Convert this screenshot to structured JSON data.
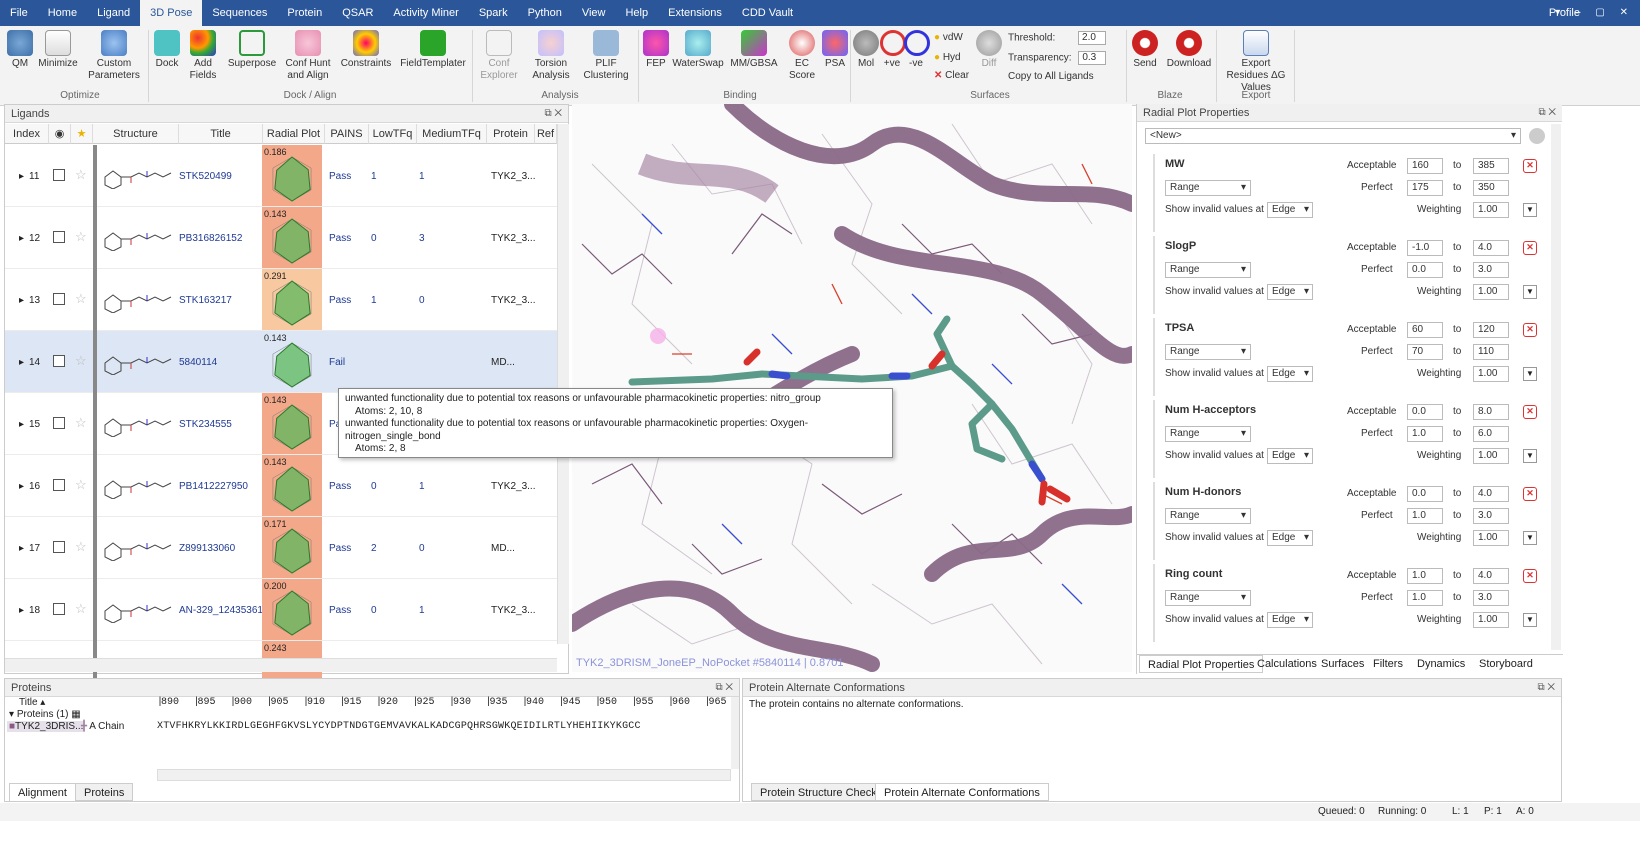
{
  "menubar": {
    "items": [
      "File",
      "Home",
      "Ligand",
      "3D Pose",
      "Sequences",
      "Protein",
      "QSAR",
      "Activity Miner",
      "Spark",
      "Python",
      "View",
      "Help",
      "Extensions",
      "CDD Vault"
    ],
    "active": "3D Pose",
    "profile": "Profile"
  },
  "ribbon": {
    "buttons": [
      {
        "label": "QM",
        "icon": "qm-icon"
      },
      {
        "label": "Minimize",
        "icon": "minimize-icon"
      },
      {
        "label": "Custom Parameters",
        "icon": "custom-parameters-icon"
      },
      {
        "label": "Dock",
        "icon": "dock-icon"
      },
      {
        "label": "Add Fields",
        "icon": "add-fields-icon"
      },
      {
        "label": "Superpose",
        "icon": "superpose-icon"
      },
      {
        "label": "Conf Hunt and Align",
        "icon": "conf-hunt-icon"
      },
      {
        "label": "Constraints",
        "icon": "constraints-icon"
      },
      {
        "label": "FieldTemplater",
        "icon": "fieldtemplater-icon"
      },
      {
        "label": "Conf Explorer",
        "icon": "conf-explorer-icon"
      },
      {
        "label": "Torsion Analysis",
        "icon": "torsion-icon"
      },
      {
        "label": "PLIF Clustering",
        "icon": "plif-icon"
      },
      {
        "label": "FEP",
        "icon": "fep-icon"
      },
      {
        "label": "WaterSwap",
        "icon": "waterswap-icon"
      },
      {
        "label": "MM/GBSA",
        "icon": "mmgbsa-icon"
      },
      {
        "label": "EC Score",
        "icon": "ecscore-icon"
      },
      {
        "label": "PSA",
        "icon": "psa-icon"
      },
      {
        "label": "Mol",
        "icon": "mol-icon"
      },
      {
        "label": "+ve",
        "icon": "positive-icon"
      },
      {
        "label": "-ve",
        "icon": "negative-icon"
      },
      {
        "label": "Diff",
        "icon": "diff-icon"
      },
      {
        "label": "Send",
        "icon": "send-icon"
      },
      {
        "label": "Download",
        "icon": "download-icon"
      },
      {
        "label": "Export Residues ΔG Values",
        "icon": "export-residues-icon"
      }
    ],
    "surfaces_small": {
      "vdw": "vdW",
      "hyd": "Hyd",
      "clear": "Clear",
      "threshold_label": "Threshold:",
      "threshold_value": "2.0",
      "transparency_label": "Transparency:",
      "transparency_value": "0.3",
      "copy": "Copy to All Ligands"
    },
    "groups": [
      "Optimize",
      "Dock / Align",
      "Analysis",
      "Binding",
      "Surfaces",
      "Blaze",
      "Export"
    ]
  },
  "ligands": {
    "title": "Ligands",
    "columns": [
      "Index",
      "",
      "",
      "Structure",
      "Title",
      "Radial Plot",
      "PAINS",
      "LowTFq",
      "MediumTFq",
      "Protein",
      "Ref"
    ],
    "rows": [
      {
        "index": "11",
        "title": "STK520499",
        "score": "0.186",
        "pains": "Pass",
        "low": "1",
        "medium": "1",
        "protein": "TYK2_3...",
        "bg": "#f4a88a"
      },
      {
        "index": "12",
        "title": "PB316826152",
        "score": "0.143",
        "pains": "Pass",
        "low": "0",
        "medium": "3",
        "protein": "TYK2_3...",
        "bg": "#f4a88a"
      },
      {
        "index": "13",
        "title": "STK163217",
        "score": "0.291",
        "pains": "Pass",
        "low": "1",
        "medium": "0",
        "protein": "TYK2_3...",
        "bg": "#f8c8a0"
      },
      {
        "index": "14",
        "title": "5840114",
        "score": "0.143",
        "pains": "Fail",
        "low": "",
        "medium": "",
        "protein": "MD...",
        "bg": "#dce6f4"
      },
      {
        "index": "15",
        "title": "STK234555",
        "score": "0.143",
        "pains": "Pa",
        "low": "",
        "medium": "",
        "protein": "",
        "bg": "#f4a88a"
      },
      {
        "index": "16",
        "title": "PB1412227950",
        "score": "0.143",
        "pains": "Pass",
        "low": "0",
        "medium": "1",
        "protein": "TYK2_3...",
        "bg": "#f4a88a"
      },
      {
        "index": "17",
        "title": "Z899133060",
        "score": "0.171",
        "pains": "Pass",
        "low": "2",
        "medium": "0",
        "protein": "MD...",
        "bg": "#f4a88a"
      },
      {
        "index": "18",
        "title": "AN-329_12435361",
        "score": "0.200",
        "pains": "Pass",
        "low": "0",
        "medium": "1",
        "protein": "TYK2_3...",
        "bg": "#f4a88a"
      },
      {
        "index": "",
        "title": "",
        "score": "0.243",
        "pains": "",
        "low": "",
        "medium": "",
        "protein": "",
        "bg": "#f4a88a"
      }
    ]
  },
  "tooltip": {
    "line1": "unwanted functionality due to potential tox reasons or unfavourable pharmacokinetic properties: nitro_group",
    "line2": "Atoms: 2, 10, 8",
    "line3": "unwanted functionality due to potential tox reasons or unfavourable pharmacokinetic properties: Oxygen-nitrogen_single_bond",
    "line4": "Atoms: 2, 8"
  },
  "viewer": {
    "caption": "TYK2_3DRISM_JoneEP_NoPocket #5840114 | 0.8701"
  },
  "props": {
    "title": "Radial Plot Properties",
    "preset": "<New>",
    "acceptable_label": "Acceptable",
    "perfect_label": "Perfect",
    "to_label": "to",
    "invalid_label": "Show invalid values at",
    "weighting_label": "Weighting",
    "properties": [
      {
        "name": "MW",
        "mode": "Range",
        "acc_min": "160",
        "acc_max": "385",
        "perf_min": "175",
        "perf_max": "350",
        "invalid": "Edge",
        "weight": "1.00"
      },
      {
        "name": "SlogP",
        "mode": "Range",
        "acc_min": "-1.0",
        "acc_max": "4.0",
        "perf_min": "0.0",
        "perf_max": "3.0",
        "invalid": "Edge",
        "weight": "1.00"
      },
      {
        "name": "TPSA",
        "mode": "Range",
        "acc_min": "60",
        "acc_max": "120",
        "perf_min": "70",
        "perf_max": "110",
        "invalid": "Edge",
        "weight": "1.00"
      },
      {
        "name": "Num H-acceptors",
        "mode": "Range",
        "acc_min": "0.0",
        "acc_max": "8.0",
        "perf_min": "1.0",
        "perf_max": "6.0",
        "invalid": "Edge",
        "weight": "1.00"
      },
      {
        "name": "Num H-donors",
        "mode": "Range",
        "acc_min": "0.0",
        "acc_max": "4.0",
        "perf_min": "1.0",
        "perf_max": "3.0",
        "invalid": "Edge",
        "weight": "1.00"
      },
      {
        "name": "Ring count",
        "mode": "Range",
        "acc_min": "1.0",
        "acc_max": "4.0",
        "perf_min": "1.0",
        "perf_max": "3.0",
        "invalid": "Edge",
        "weight": "1.00"
      }
    ],
    "tabs": [
      "Radial Plot Properties",
      "Calculations",
      "Surfaces",
      "Filters",
      "Dynamics",
      "Storyboard"
    ]
  },
  "proteins": {
    "title": "Proteins",
    "ruler": [
      "890",
      "895",
      "900",
      "905",
      "910",
      "915",
      "920",
      "925",
      "930",
      "935",
      "940",
      "945",
      "950",
      "955",
      "960",
      "965"
    ],
    "tree_title": "Title",
    "tree_group": "Proteins (1)",
    "tree_item": "TYK2_3DRIS...",
    "chain": "A Chain",
    "sequence": "XTVFHKRYLKKIRDLGEGHFGKVSLYCYDPTNDGTGEMVAVKALKADCGPQHRSGWKQEIDILRTLYHEHIIKYKGCC",
    "tabs": [
      "Alignment",
      "Proteins"
    ]
  },
  "altconf": {
    "title": "Protein Alternate Conformations",
    "message": "The protein contains no alternate conformations.",
    "tabs": [
      "Protein Structure Checker",
      "Protein Alternate Conformations"
    ]
  },
  "status": {
    "queued": "Queued: 0",
    "running": "Running: 0",
    "l": "L: 1",
    "p": "P: 1",
    "a": "A: 0"
  }
}
